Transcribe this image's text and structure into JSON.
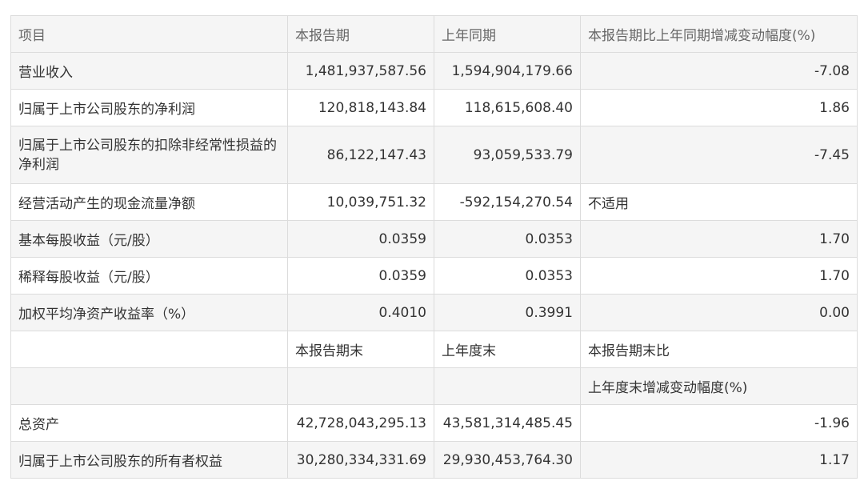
{
  "header": {
    "col1": "项目",
    "col2": "本报告期",
    "col3": "上年同期",
    "col4": "本报告期比上年同期增减变动幅度(%)"
  },
  "rows": [
    {
      "item": "营业收入",
      "current": "1,481,937,587.56",
      "prior": "1,594,904,179.66",
      "change": "-7.08"
    },
    {
      "item": "归属于上市公司股东的净利润",
      "current": "120,818,143.84",
      "prior": "118,615,608.40",
      "change": "1.86"
    },
    {
      "item": "归属于上市公司股东的扣除非经常性损益的净利润",
      "current": "86,122,147.43",
      "prior": "93,059,533.79",
      "change": "-7.45"
    },
    {
      "item": "经营活动产生的现金流量净额",
      "current": "10,039,751.32",
      "prior": "-592,154,270.54",
      "change": "不适用"
    },
    {
      "item": "基本每股收益（元/股）",
      "current": "0.0359",
      "prior": "0.0353",
      "change": "1.70"
    },
    {
      "item": "稀释每股收益（元/股）",
      "current": "0.0359",
      "prior": "0.0353",
      "change": "1.70"
    },
    {
      "item": "加权平均净资产收益率（%）",
      "current": "0.4010",
      "prior": "0.3991",
      "change": "0.00"
    }
  ],
  "period_end_header": {
    "col1": "",
    "col2": "本报告期末",
    "col3": "上年度末",
    "col4": "本报告期末比"
  },
  "period_end_subheader": {
    "col4": "上年度末增减变动幅度(%)"
  },
  "period_end_rows": [
    {
      "item": "总资产",
      "current": "42,728,043,295.13",
      "prior": "43,581,314,485.45",
      "change": "-1.96"
    },
    {
      "item": "归属于上市公司股东的所有者权益",
      "current": "30,280,334,331.69",
      "prior": "29,930,453,764.30",
      "change": "1.17"
    }
  ]
}
